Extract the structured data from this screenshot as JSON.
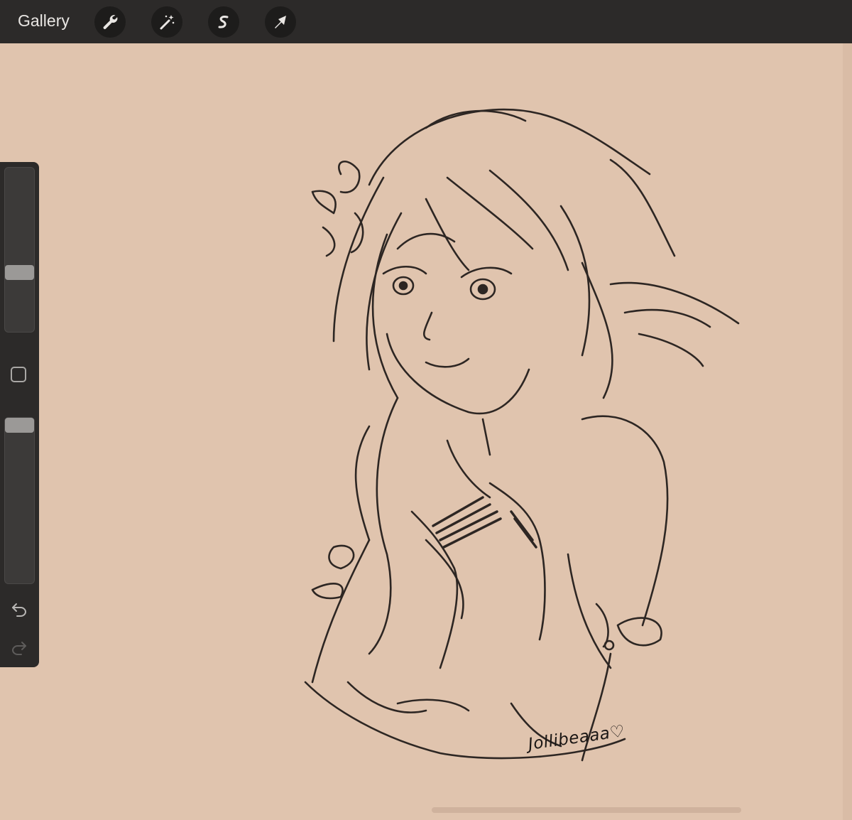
{
  "topbar": {
    "gallery_label": "Gallery",
    "tools": [
      {
        "name": "actions",
        "icon": "wrench-icon"
      },
      {
        "name": "adjustments",
        "icon": "magic-wand-icon"
      },
      {
        "name": "selection",
        "icon": "selection-s-icon"
      },
      {
        "name": "transform",
        "icon": "arrow-cursor-icon"
      }
    ]
  },
  "sidebar": {
    "brush_size_level": 0.63,
    "opacity_level": 0.0,
    "modify_icon": "square-icon",
    "undo_icon": "undo-icon",
    "redo_icon": "redo-icon"
  },
  "canvas": {
    "background_color": "#e0c4ae",
    "ink_color": "#1a1614",
    "signature": "Jollibeaaa♡"
  },
  "colors": {
    "toolbar": "#2c2a29",
    "tool_button": "#1d1c1b",
    "slider_thumb": "#9b9997"
  }
}
